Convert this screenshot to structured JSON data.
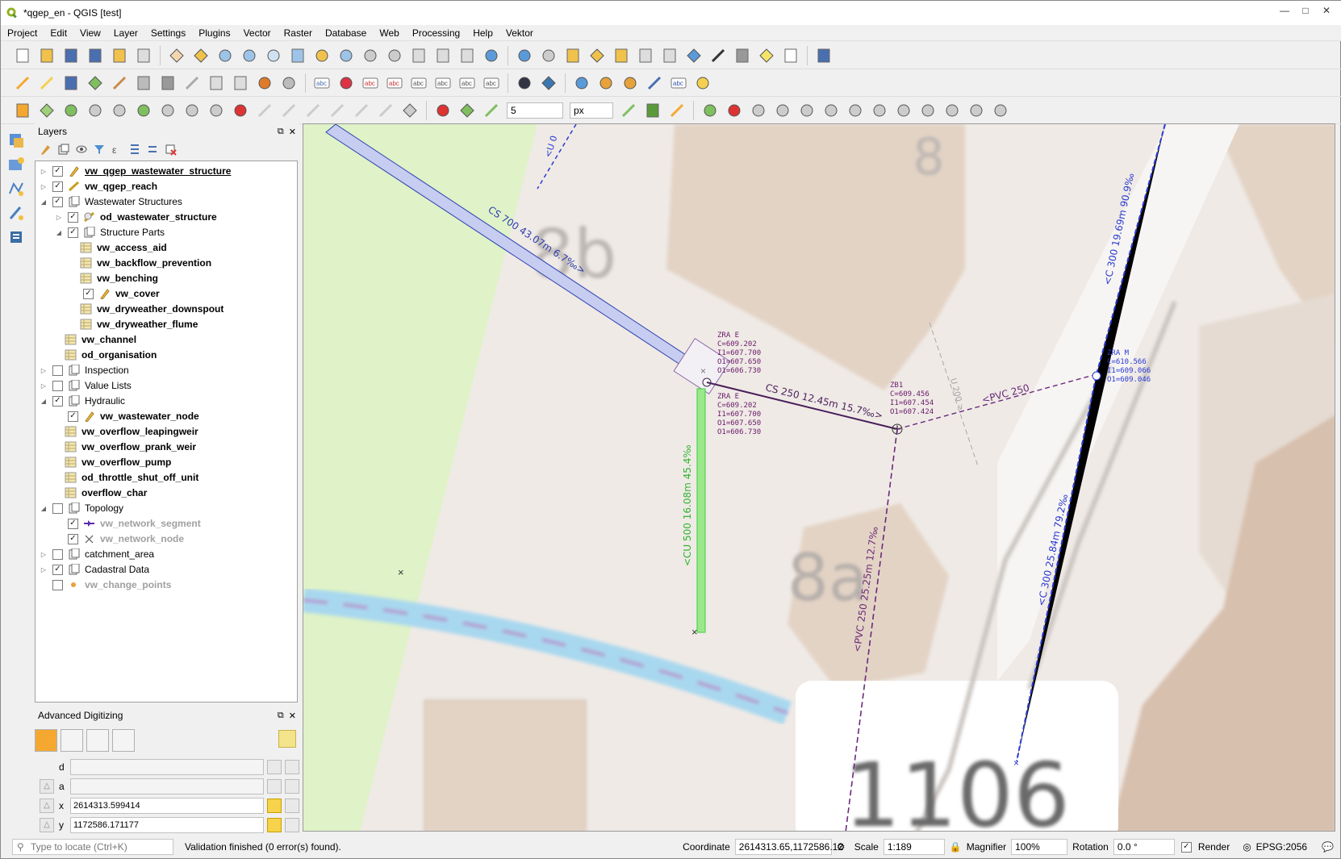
{
  "window": {
    "title": "*qgep_en - QGIS [test]"
  },
  "menu": [
    "Project",
    "Edit",
    "View",
    "Layer",
    "Settings",
    "Plugins",
    "Vector",
    "Raster",
    "Database",
    "Web",
    "Processing",
    "Help",
    "Vektor"
  ],
  "snapping": {
    "tolerance": "5",
    "unit": "px"
  },
  "layers_panel": {
    "title": "Layers"
  },
  "layers": [
    {
      "label": "vw_qgep_wastewater_structure",
      "checked": true,
      "expand": "closed",
      "indent": 0,
      "style": "bold underline",
      "icon": "pencil-line"
    },
    {
      "label": "vw_qgep_reach",
      "checked": true,
      "expand": "closed",
      "indent": 0,
      "style": "bold",
      "icon": "line-style"
    },
    {
      "label": "Wastewater Structures",
      "checked": true,
      "expand": "open",
      "indent": 0,
      "style": "normal",
      "icon": "group"
    },
    {
      "label": "od_wastewater_structure",
      "checked": true,
      "expand": "closed",
      "indent": 1,
      "style": "bold",
      "icon": "polygon-style"
    },
    {
      "label": "Structure Parts",
      "checked": true,
      "expand": "open",
      "indent": 1,
      "style": "normal",
      "icon": "group"
    },
    {
      "label": "vw_access_aid",
      "checked": null,
      "expand": "none",
      "indent": 2,
      "style": "bold",
      "icon": "table"
    },
    {
      "label": "vw_backflow_prevention",
      "checked": null,
      "expand": "none",
      "indent": 2,
      "style": "bold",
      "icon": "table"
    },
    {
      "label": "vw_benching",
      "checked": null,
      "expand": "none",
      "indent": 2,
      "style": "bold",
      "icon": "table"
    },
    {
      "label": "vw_cover",
      "checked": true,
      "expand": "none",
      "indent": 2,
      "style": "bold",
      "icon": "pencil"
    },
    {
      "label": "vw_dryweather_downspout",
      "checked": null,
      "expand": "none",
      "indent": 2,
      "style": "bold",
      "icon": "table"
    },
    {
      "label": "vw_dryweather_flume",
      "checked": null,
      "expand": "none",
      "indent": 2,
      "style": "bold",
      "icon": "table"
    },
    {
      "label": "vw_channel",
      "checked": null,
      "expand": "none",
      "indent": 1,
      "style": "bold",
      "icon": "table"
    },
    {
      "label": "od_organisation",
      "checked": null,
      "expand": "none",
      "indent": 1,
      "style": "bold",
      "icon": "table"
    },
    {
      "label": "Inspection",
      "checked": false,
      "expand": "closed",
      "indent": 0,
      "style": "normal",
      "icon": "group"
    },
    {
      "label": "Value Lists",
      "checked": false,
      "expand": "closed",
      "indent": 0,
      "style": "normal",
      "icon": "group"
    },
    {
      "label": "Hydraulic",
      "checked": true,
      "expand": "open",
      "indent": 0,
      "style": "normal",
      "icon": "group"
    },
    {
      "label": "vw_wastewater_node",
      "checked": true,
      "expand": "none",
      "indent": 1,
      "style": "bold",
      "icon": "pencil"
    },
    {
      "label": "vw_overflow_leapingweir",
      "checked": null,
      "expand": "none",
      "indent": 1,
      "style": "bold",
      "icon": "table"
    },
    {
      "label": "vw_overflow_prank_weir",
      "checked": null,
      "expand": "none",
      "indent": 1,
      "style": "bold",
      "icon": "table"
    },
    {
      "label": "vw_overflow_pump",
      "checked": null,
      "expand": "none",
      "indent": 1,
      "style": "bold",
      "icon": "table"
    },
    {
      "label": "od_throttle_shut_off_unit",
      "checked": null,
      "expand": "none",
      "indent": 1,
      "style": "bold",
      "icon": "table"
    },
    {
      "label": "overflow_char",
      "checked": null,
      "expand": "none",
      "indent": 1,
      "style": "bold",
      "icon": "table"
    },
    {
      "label": "Topology",
      "checked": false,
      "expand": "open",
      "indent": 0,
      "style": "normal",
      "icon": "group"
    },
    {
      "label": "vw_network_segment",
      "checked": true,
      "expand": "none",
      "indent": 1,
      "style": "bold grey",
      "icon": "segment"
    },
    {
      "label": "vw_network_node",
      "checked": true,
      "expand": "none",
      "indent": 1,
      "style": "bold grey",
      "icon": "cross"
    },
    {
      "label": "catchment_area",
      "checked": false,
      "expand": "closed",
      "indent": 0,
      "style": "normal",
      "icon": "group"
    },
    {
      "label": "Cadastral Data",
      "checked": true,
      "expand": "closed",
      "indent": 0,
      "style": "normal",
      "icon": "group"
    },
    {
      "label": "vw_change_points",
      "checked": false,
      "expand": "none",
      "indent": 0,
      "style": "bold grey",
      "icon": "dot"
    }
  ],
  "adv_panel": {
    "title": "Advanced Digitizing",
    "fields": [
      {
        "label": "d",
        "value": ""
      },
      {
        "label": "a",
        "value": ""
      },
      {
        "label": "x",
        "value": "2614313.599414"
      },
      {
        "label": "y",
        "value": "1172586.171177"
      }
    ]
  },
  "map": {
    "house_numbers": [
      "8",
      "8b",
      "8a",
      "1106"
    ],
    "pipe_labels": {
      "cs700": "CS 700 43.07m 6.7‰>",
      "cs250": "CS 250 12.45m 15.7‰>",
      "pvc250_up": "<PVC 250",
      "pvc250_down": "<PVC 250 25.25m 12.7‰",
      "cu500": "<CU 500 16.08m 45.4‰",
      "c300_top": "<C 300 19.69m 90.9‰",
      "c300_bottom": "<C 300 25.84m 79.2‰",
      "u0": "<U 0",
      "u200": "U 200 >"
    },
    "node_labels": {
      "zrae1": [
        "ZRA E",
        "C=609.202",
        "I1=607.700",
        "O1=607.650",
        "O1=606.730"
      ],
      "zrae2": [
        "ZRA E",
        "C=609.202",
        "I1=607.700",
        "O1=607.650",
        "O1=606.730"
      ],
      "zb1": [
        "ZB1",
        "C=609.456",
        "I1=607.454",
        "O1=607.424"
      ],
      "zram": [
        "ZRA M",
        "C=610.566",
        "I1=609.066",
        "O1=609.046"
      ]
    }
  },
  "status": {
    "search_placeholder": "Type to locate (Ctrl+K)",
    "message": "Validation finished (0 error(s) found).",
    "coordinate_label": "Coordinate",
    "coordinate": "2614313.65,1172586.12",
    "scale_label": "Scale",
    "scale": "1:189",
    "magnifier_label": "Magnifier",
    "magnifier": "100%",
    "rotation_label": "Rotation",
    "rotation": "0.0 °",
    "render_label": "Render",
    "epsg": "EPSG:2056"
  }
}
